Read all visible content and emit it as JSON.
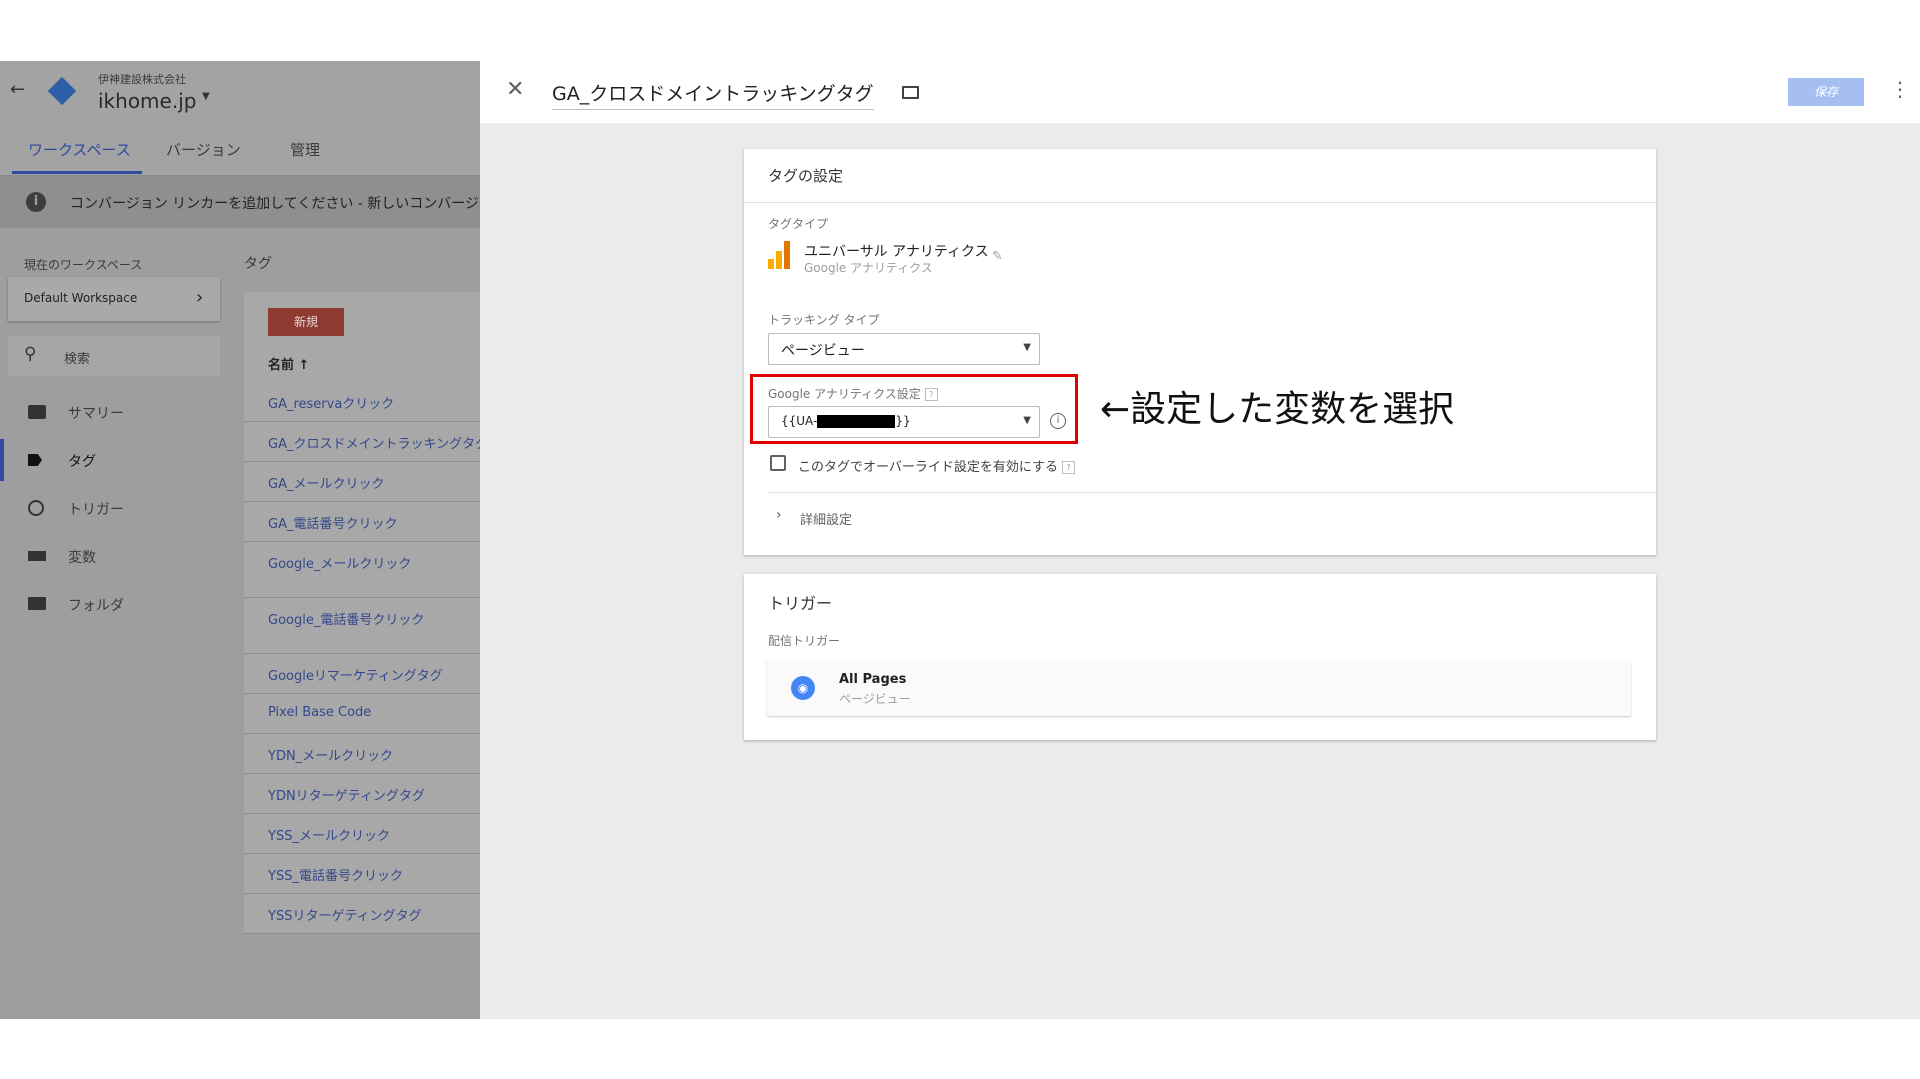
{
  "left": {
    "company": "伊神建設株式会社",
    "container": "ikhome.jp",
    "tabs": [
      "ワークスペース",
      "バージョン",
      "管理"
    ],
    "notice": "コンバージョン リンカーを追加してください - 新しいコンバージョン",
    "workspace_label": "現在のワークスペース",
    "workspace_name": "Default Workspace",
    "search_placeholder": "検索",
    "nav": [
      "サマリー",
      "タグ",
      "トリガー",
      "変数",
      "フォルダ"
    ],
    "tags_title": "タグ",
    "new_button": "新規",
    "col_name": "名前 ↑",
    "tag_rows": [
      "GA_reservaクリック",
      "GA_クロスドメイントラッキングタグ",
      "GA_メールクリック",
      "GA_電話番号クリック",
      "Google_メールクリック",
      "Google_電話番号クリック",
      "Googleリマーケティングタグ",
      "Pixel Base Code",
      "YDN_メールクリック",
      "YDNリターゲティングタグ",
      "YSS_メールクリック",
      "YSS_電話番号クリック",
      "YSSリターゲティングタグ"
    ]
  },
  "editor": {
    "title": "GA_クロスドメイントラッキングタグ",
    "save": "保存",
    "config": {
      "heading": "タグの設定",
      "tag_type_label": "タグタイプ",
      "tag_type": "ユニバーサル アナリティクス",
      "tag_type_sub": "Google アナリティクス",
      "tracking_label": "トラッキング タイプ",
      "tracking_value": "ページビュー",
      "ga_settings_label": "Google アナリティクス設定",
      "ga_settings_value_prefix": "{{UA-",
      "ga_settings_value_suffix": "}}",
      "override_label": "このタグでオーバーライド設定を有効にする",
      "advanced": "詳細設定"
    },
    "trigger": {
      "heading": "トリガー",
      "firing_label": "配信トリガー",
      "name": "All Pages",
      "type": "ページビュー"
    }
  },
  "annotation": "←設定した変数を選択",
  "colors": {
    "accent_blue": "#4285f4",
    "new_button": "#b03a2e",
    "highlight_box": "#e00000",
    "save_button": "#a5bff2"
  }
}
